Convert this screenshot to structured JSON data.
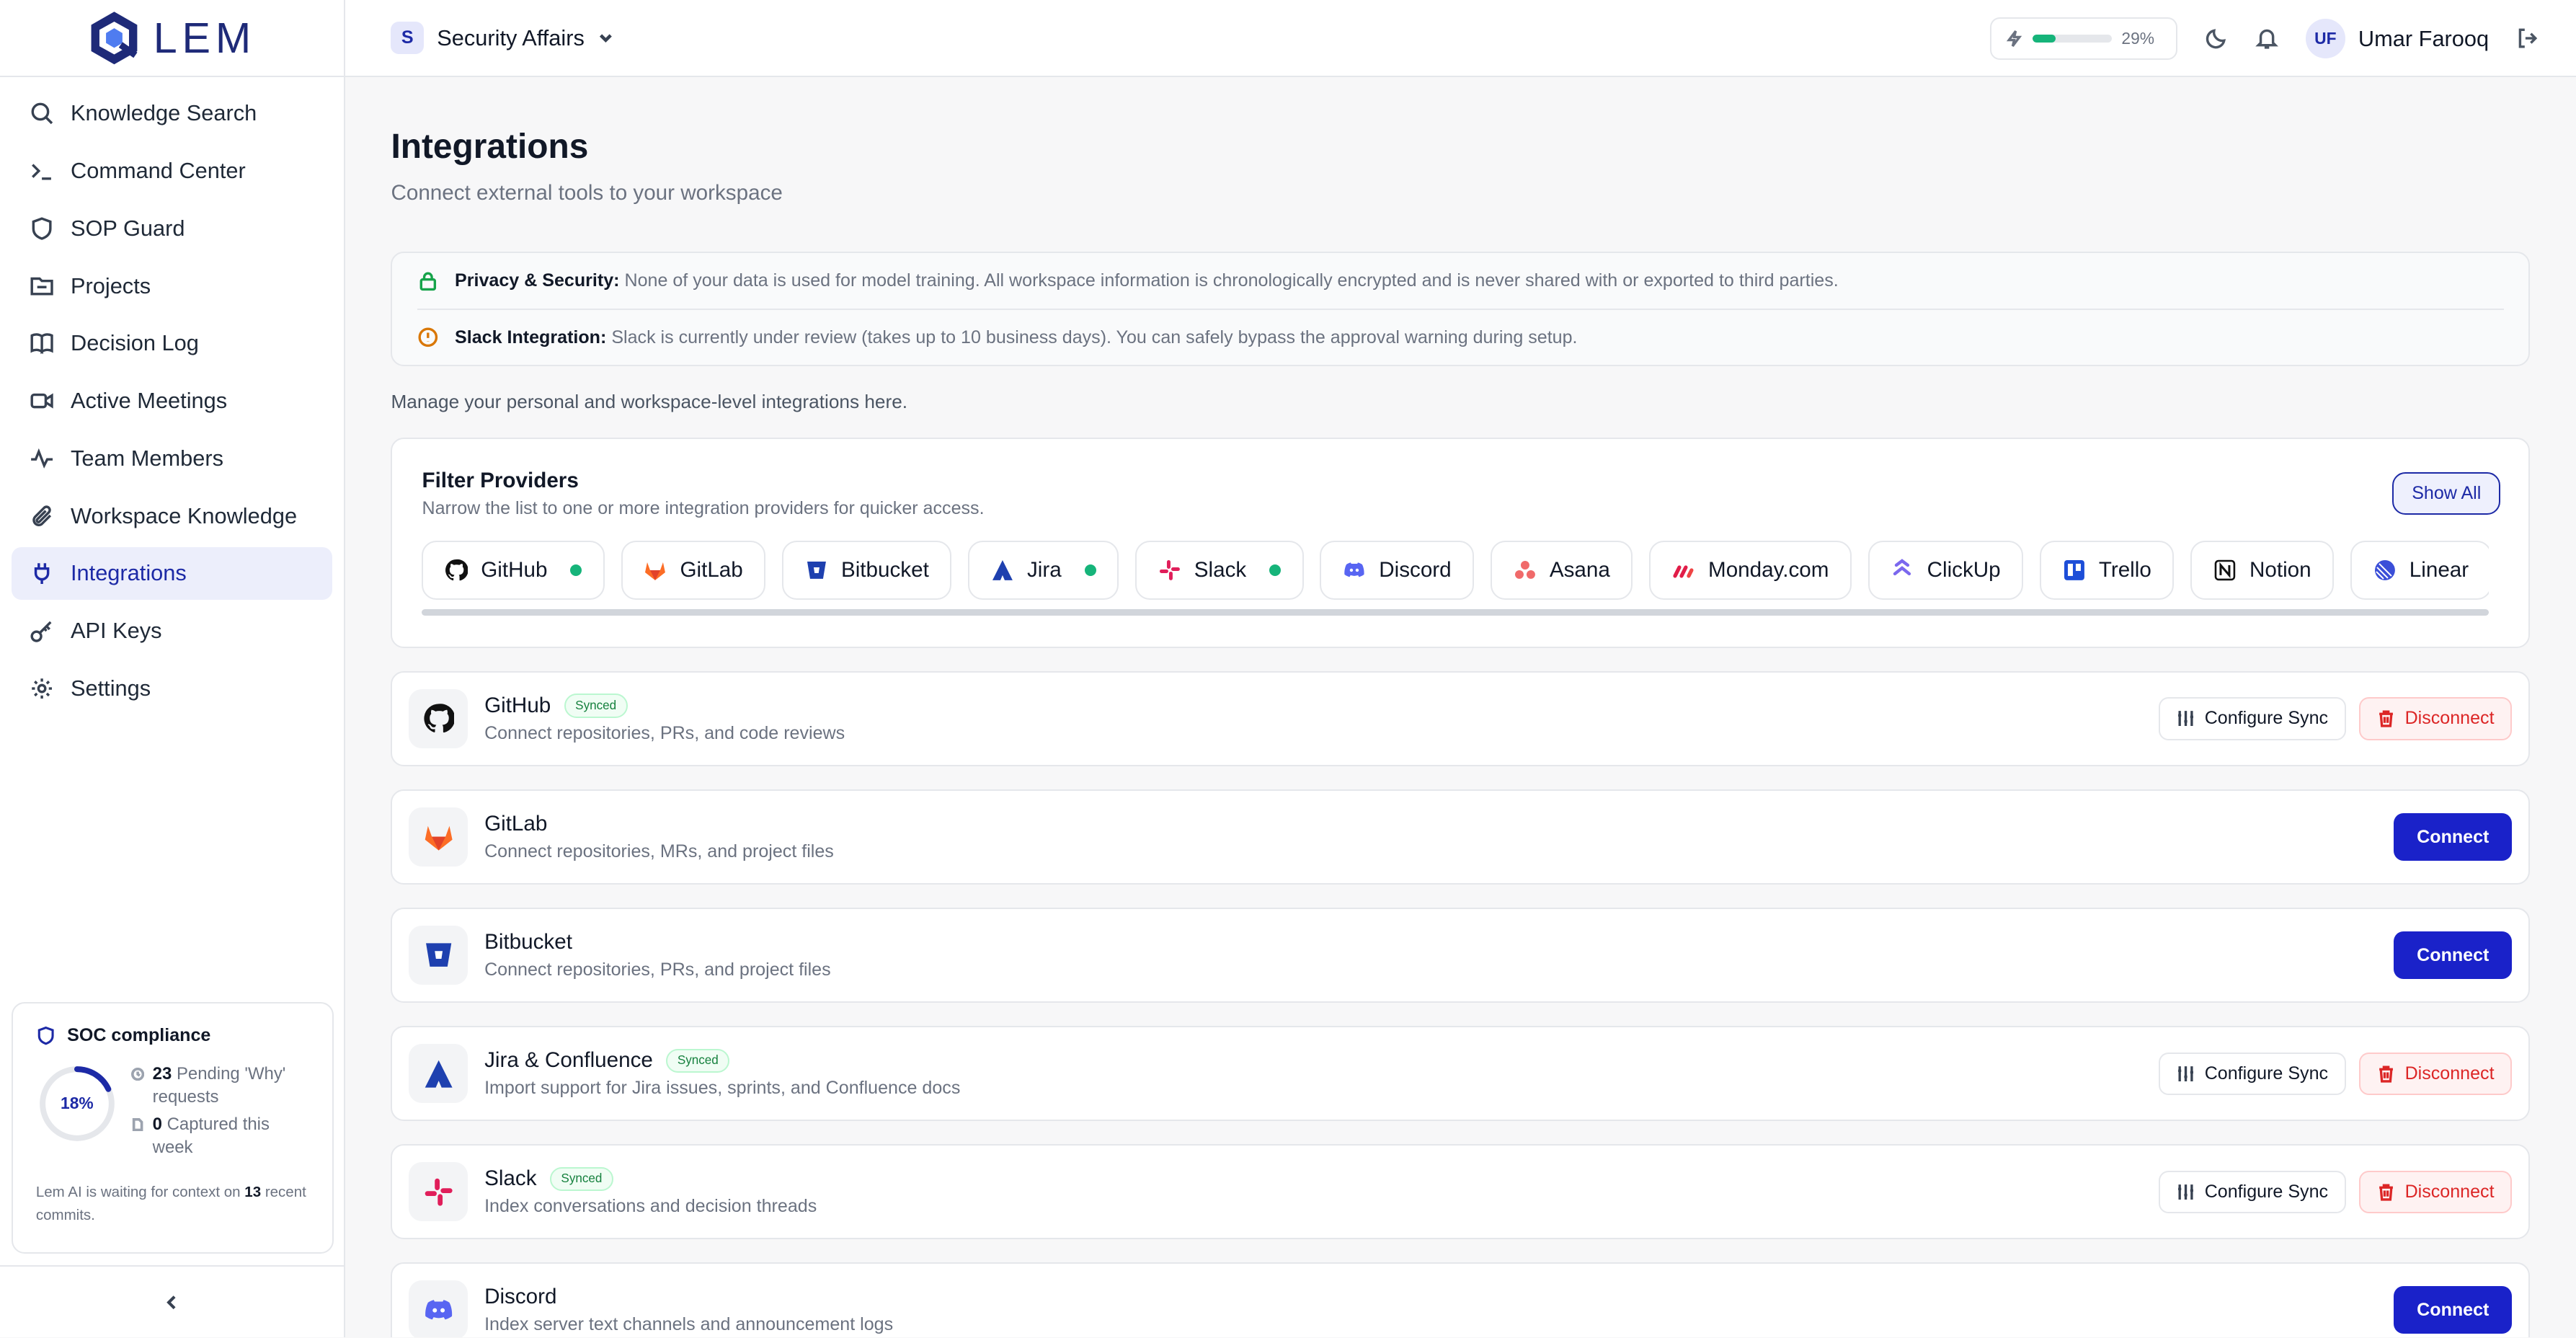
{
  "brand": {
    "name": "LEM"
  },
  "sidebar": {
    "items": [
      {
        "label": "Knowledge Search"
      },
      {
        "label": "Command Center"
      },
      {
        "label": "SOP Guard"
      },
      {
        "label": "Projects"
      },
      {
        "label": "Decision Log"
      },
      {
        "label": "Active Meetings"
      },
      {
        "label": "Team Members"
      },
      {
        "label": "Workspace Knowledge"
      },
      {
        "label": "Integrations",
        "active": true
      },
      {
        "label": "API Keys"
      },
      {
        "label": "Settings"
      }
    ],
    "soc": {
      "title": "SOC compliance",
      "percent_label": "18%",
      "percent": 0.18,
      "pending_count": "23",
      "pending_text": "Pending 'Why' requests",
      "captured_count": "0",
      "captured_text": "Captured this week",
      "note_prefix": "Lem AI is waiting for context on",
      "note_count": "13",
      "note_suffix": "recent commits."
    }
  },
  "topbar": {
    "workspace_initial": "S",
    "workspace_name": "Security Affairs",
    "usage_label": "29%",
    "usage_fraction": 0.29,
    "user_initials": "UF",
    "user_name": "Umar Farooq"
  },
  "page": {
    "title": "Integrations",
    "subtitle": "Connect external tools to your workspace",
    "privacy_label": "Privacy & Security:",
    "privacy_text": "None of your data is used for model training. All workspace information is chronologically encrypted and is never shared with or exported to third parties.",
    "slack_label": "Slack Integration:",
    "slack_text": "Slack is currently under review (takes up to 10 business days). You can safely bypass the approval warning during setup.",
    "manage_text": "Manage your personal and workspace-level integrations here."
  },
  "filter": {
    "title": "Filter Providers",
    "subtitle": "Narrow the list to one or more integration providers for quicker access.",
    "show_all": "Show All",
    "chips": [
      {
        "label": "GitHub",
        "connected": true
      },
      {
        "label": "GitLab",
        "connected": false
      },
      {
        "label": "Bitbucket",
        "connected": false
      },
      {
        "label": "Jira",
        "connected": true
      },
      {
        "label": "Slack",
        "connected": true
      },
      {
        "label": "Discord",
        "connected": false
      },
      {
        "label": "Asana",
        "connected": false
      },
      {
        "label": "Monday.com",
        "connected": false
      },
      {
        "label": "ClickUp",
        "connected": false
      },
      {
        "label": "Trello",
        "connected": false
      },
      {
        "label": "Notion",
        "connected": false
      },
      {
        "label": "Linear",
        "connected": false
      }
    ]
  },
  "integrations": [
    {
      "name": "GitHub",
      "badge": "Synced",
      "desc": "Connect repositories, PRs, and code reviews",
      "configure": "Configure Sync",
      "disconnect": "Disconnect"
    },
    {
      "name": "GitLab",
      "desc": "Connect repositories, MRs, and project files",
      "connect": "Connect"
    },
    {
      "name": "Bitbucket",
      "desc": "Connect repositories, PRs, and project files",
      "connect": "Connect"
    },
    {
      "name": "Jira & Confluence",
      "badge": "Synced",
      "desc": "Import support for Jira issues, sprints, and Confluence docs",
      "configure": "Configure Sync",
      "disconnect": "Disconnect"
    },
    {
      "name": "Slack",
      "badge": "Synced",
      "desc": "Index conversations and decision threads",
      "configure": "Configure Sync",
      "disconnect": "Disconnect"
    },
    {
      "name": "Discord",
      "desc": "Index server text channels and announcement logs",
      "connect": "Connect"
    }
  ],
  "colors": {
    "accent": "#1d2aa6",
    "primary_button": "#1a22c9",
    "success": "#16b47a",
    "danger": "#dc2626"
  }
}
